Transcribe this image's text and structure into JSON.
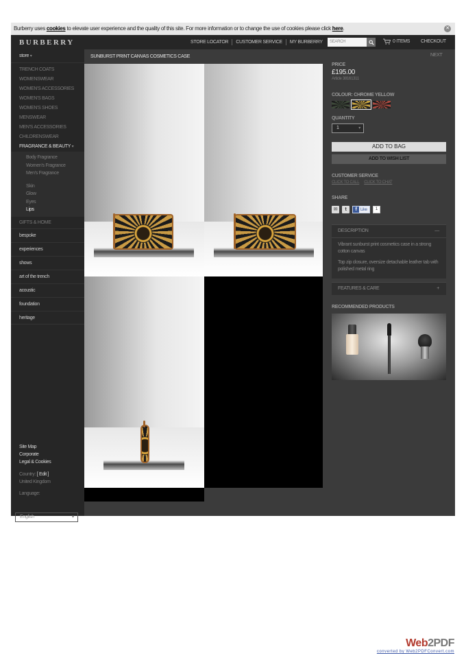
{
  "cookie": {
    "text_before": "Burberry uses ",
    "link_cookies": "cookies",
    "text_middle": " to elevate user experience and the quality of this site. For more information or to change the use of cookies please click ",
    "link_here": "here",
    "text_end": ".",
    "close_glyph": "✕"
  },
  "header": {
    "logo": "BURBERRY",
    "nav": [
      "STORE LOCATOR",
      "CUSTOMER SERVICE",
      "MY BURBERRY"
    ],
    "search_placeholder": "SEARCH",
    "bag": "0 ITEMS",
    "checkout": "CHECKOUT"
  },
  "sidebar": {
    "store": "store",
    "categories": [
      "TRENCH COATS",
      "WOMENSWEAR",
      "WOMEN'S ACCESSORIES",
      "WOMEN'S BAGS",
      "WOMEN'S SHOES",
      "MENSWEAR",
      "MEN'S ACCESSORIES",
      "CHILDRENSWEAR"
    ],
    "active_category": "FRAGRANCE & BEAUTY",
    "fragrance": [
      "Body Fragrance",
      "Women's Fragrance",
      "Men's Fragrance"
    ],
    "beauty": [
      "Skin",
      "Glow",
      "Eyes"
    ],
    "beauty_selected": "Lips",
    "gifts": "GIFTS & HOME",
    "sections": [
      "bespoke",
      "experiences",
      "shows",
      "art of the trench",
      "acoustic",
      "foundation",
      "heritage"
    ],
    "footer_links": [
      "Site Map",
      "Corporate",
      "Legal & Cookies"
    ],
    "country_label": "Country:",
    "country_edit": "[ Edit ]",
    "country": "United Kingdom",
    "language_label": "Language:",
    "language": "English"
  },
  "product": {
    "title": "SUNBURST PRINT CANVAS COSMETICS CASE",
    "next": "NEXT",
    "price_label": "PRICE",
    "price": "£195.00",
    "article": "Article 38161311",
    "colour_label": "COLOUR: CHROME YELLOW",
    "quantity_label": "QUANTITY",
    "quantity": "1",
    "add_to_bag": "ADD TO BAG",
    "add_to_wishlist": "ADD TO WISH LIST",
    "customer_service_label": "CUSTOMER SERVICE",
    "click_to_call": "CLICK TO CALL",
    "click_to_chat": "CLICK TO CHAT",
    "share_label": "SHARE",
    "like": "Like",
    "like_count": "1",
    "description_label": "DESCRIPTION",
    "description_toggle": "—",
    "description": [
      "Vibrant sunburst print cosmetics case in a strong cotton canvas",
      "Top zip closure, oversize detachable leather tab with polished metal ring"
    ],
    "features_label": "FEATURES & CARE",
    "features_toggle": "+",
    "recommended_label": "RECOMMENDED PRODUCTS"
  },
  "colors": {
    "swatch_1": "#3e4a3a",
    "swatch_2": "#c9a43f",
    "swatch_3": "#a9493f"
  },
  "badge": {
    "brand_a": "Web",
    "brand_b": "2PDF",
    "converted": "converted by Web2PDFConvert.com"
  }
}
